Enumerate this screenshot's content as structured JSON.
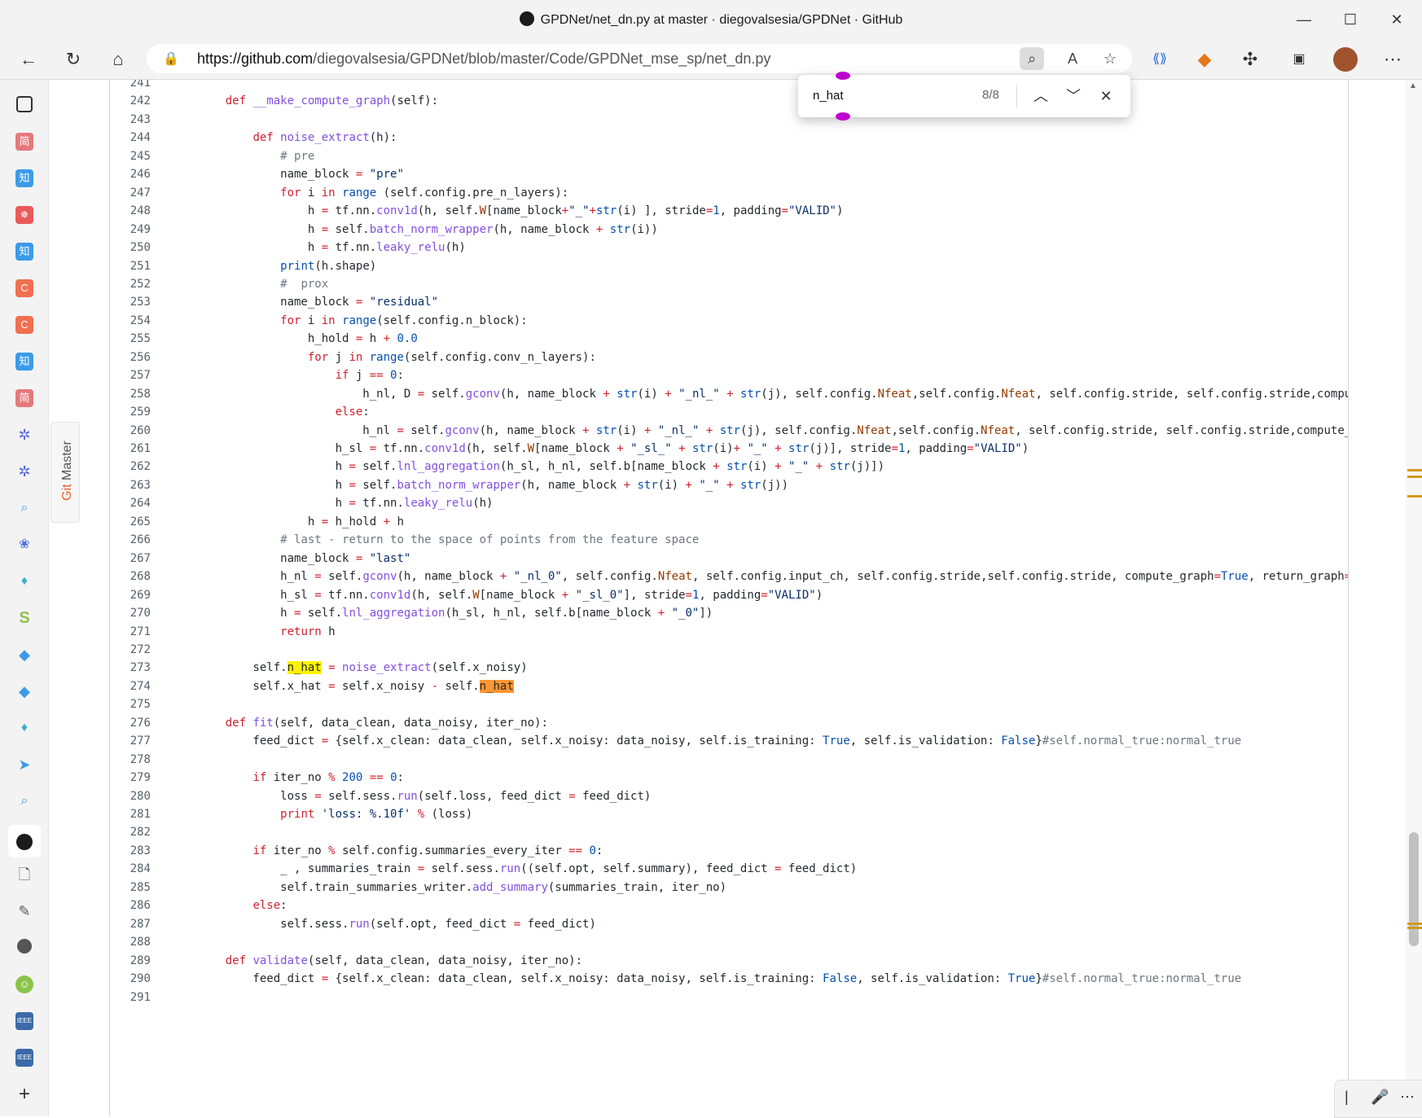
{
  "window": {
    "title": "GPDNet/net_dn.py at master · diegovalsesia/GPDNet · GitHub"
  },
  "toolbar": {
    "url_domain": "https://github.com",
    "url_path": "/diegovalsesia/GPDNet/blob/master/Code/GPDNet_mse_sp/net_dn.py"
  },
  "find": {
    "query": "n_hat",
    "count": "8/8"
  },
  "gitmaster": {
    "label_git": "Git",
    "label_master": " Master"
  },
  "sidebar": {
    "icons": [
      "tab-actions-icon",
      "简",
      "知",
      "✵",
      "知",
      "C",
      "C",
      "知",
      "简",
      "✲",
      "✲",
      "search-icon",
      "paw-icon",
      "drop-icon",
      "S",
      "diamond-icon",
      "diamond-icon",
      "drop-icon",
      "arrow-icon",
      "search-icon",
      "github-icon",
      "document-icon",
      "document-icon",
      "github-icon",
      "smile-icon",
      "IEEE",
      "IEEE",
      "plus-icon"
    ]
  },
  "code": [
    {
      "n": "241",
      "t": ""
    },
    {
      "n": "242",
      "t": "    def __make_compute_graph(self):"
    },
    {
      "n": "243",
      "t": ""
    },
    {
      "n": "244",
      "t": "        def noise_extract(h):"
    },
    {
      "n": "245",
      "t": "            # pre"
    },
    {
      "n": "246",
      "t": "            name_block = \"pre\""
    },
    {
      "n": "247",
      "t": "            for i in range (self.config.pre_n_layers):"
    },
    {
      "n": "248",
      "t": "                h = tf.nn.conv1d(h, self.W[name_block+\"_\"+str(i) ], stride=1, padding=\"VALID\")"
    },
    {
      "n": "249",
      "t": "                h = self.batch_norm_wrapper(h, name_block + str(i))"
    },
    {
      "n": "250",
      "t": "                h = tf.nn.leaky_relu(h)"
    },
    {
      "n": "251",
      "t": "            print(h.shape)"
    },
    {
      "n": "252",
      "t": "            #  prox"
    },
    {
      "n": "253",
      "t": "            name_block = \"residual\""
    },
    {
      "n": "254",
      "t": "            for i in range(self.config.n_block):"
    },
    {
      "n": "255",
      "t": "                h_hold = h + 0.0"
    },
    {
      "n": "256",
      "t": "                for j in range(self.config.conv_n_layers):"
    },
    {
      "n": "257",
      "t": "                    if j == 0:"
    },
    {
      "n": "258",
      "t": "                        h_nl, D = self.gconv(h, name_block + str(i) + \"_nl_\" + str(j), self.config.Nfeat,self.config.Nfeat, self.config.stride, self.config.stride,compute_grap"
    },
    {
      "n": "259",
      "t": "                    else:"
    },
    {
      "n": "260",
      "t": "                        h_nl = self.gconv(h, name_block + str(i) + \"_nl_\" + str(j), self.config.Nfeat,self.config.Nfeat, self.config.stride, self.config.stride,compute_graph=F"
    },
    {
      "n": "261",
      "t": "                    h_sl = tf.nn.conv1d(h, self.W[name_block + \"_sl_\" + str(i)+ \"_\" + str(j)], stride=1, padding=\"VALID\")"
    },
    {
      "n": "262",
      "t": "                    h = self.lnl_aggregation(h_sl, h_nl, self.b[name_block + str(i) + \"_\" + str(j)])"
    },
    {
      "n": "263",
      "t": "                    h = self.batch_norm_wrapper(h, name_block + str(i) + \"_\" + str(j))"
    },
    {
      "n": "264",
      "t": "                    h = tf.nn.leaky_relu(h)"
    },
    {
      "n": "265",
      "t": "                h = h_hold + h"
    },
    {
      "n": "266",
      "t": "            # last - return to the space of points from the feature space"
    },
    {
      "n": "267",
      "t": "            name_block = \"last\""
    },
    {
      "n": "268",
      "t": "            h_nl = self.gconv(h, name_block + \"_nl_0\", self.config.Nfeat, self.config.input_ch, self.config.stride,self.config.stride, compute_graph=True, return_graph=False)"
    },
    {
      "n": "269",
      "t": "            h_sl = tf.nn.conv1d(h, self.W[name_block + \"_sl_0\"], stride=1, padding=\"VALID\")"
    },
    {
      "n": "270",
      "t": "            h = self.lnl_aggregation(h_sl, h_nl, self.b[name_block + \"_0\"])"
    },
    {
      "n": "271",
      "t": "            return h"
    },
    {
      "n": "272",
      "t": ""
    },
    {
      "n": "273",
      "t": "        self.n_hat = noise_extract(self.x_noisy)"
    },
    {
      "n": "274",
      "t": "        self.x_hat = self.x_noisy - self.n_hat"
    },
    {
      "n": "275",
      "t": ""
    },
    {
      "n": "276",
      "t": "    def fit(self, data_clean, data_noisy, iter_no):"
    },
    {
      "n": "277",
      "t": "        feed_dict = {self.x_clean: data_clean, self.x_noisy: data_noisy, self.is_training: True, self.is_validation: False}#self.normal_true:normal_true"
    },
    {
      "n": "278",
      "t": ""
    },
    {
      "n": "279",
      "t": "        if iter_no % 200 == 0:"
    },
    {
      "n": "280",
      "t": "            loss = self.sess.run(self.loss, feed_dict = feed_dict)"
    },
    {
      "n": "281",
      "t": "            print 'loss: %.10f' % (loss)"
    },
    {
      "n": "282",
      "t": ""
    },
    {
      "n": "283",
      "t": "        if iter_no % self.config.summaries_every_iter == 0:"
    },
    {
      "n": "284",
      "t": "            _ , summaries_train = self.sess.run((self.opt, self.summary), feed_dict = feed_dict)"
    },
    {
      "n": "285",
      "t": "            self.train_summaries_writer.add_summary(summaries_train, iter_no)"
    },
    {
      "n": "286",
      "t": "        else:"
    },
    {
      "n": "287",
      "t": "            self.sess.run(self.opt, feed_dict = feed_dict)"
    },
    {
      "n": "288",
      "t": ""
    },
    {
      "n": "289",
      "t": "    def validate(self, data_clean, data_noisy, iter_no):"
    },
    {
      "n": "290",
      "t": "        feed_dict = {self.x_clean: data_clean, self.x_noisy: data_noisy, self.is_training: False, self.is_validation: True}#self.normal_true:normal_true"
    },
    {
      "n": "291",
      "t": ""
    }
  ]
}
